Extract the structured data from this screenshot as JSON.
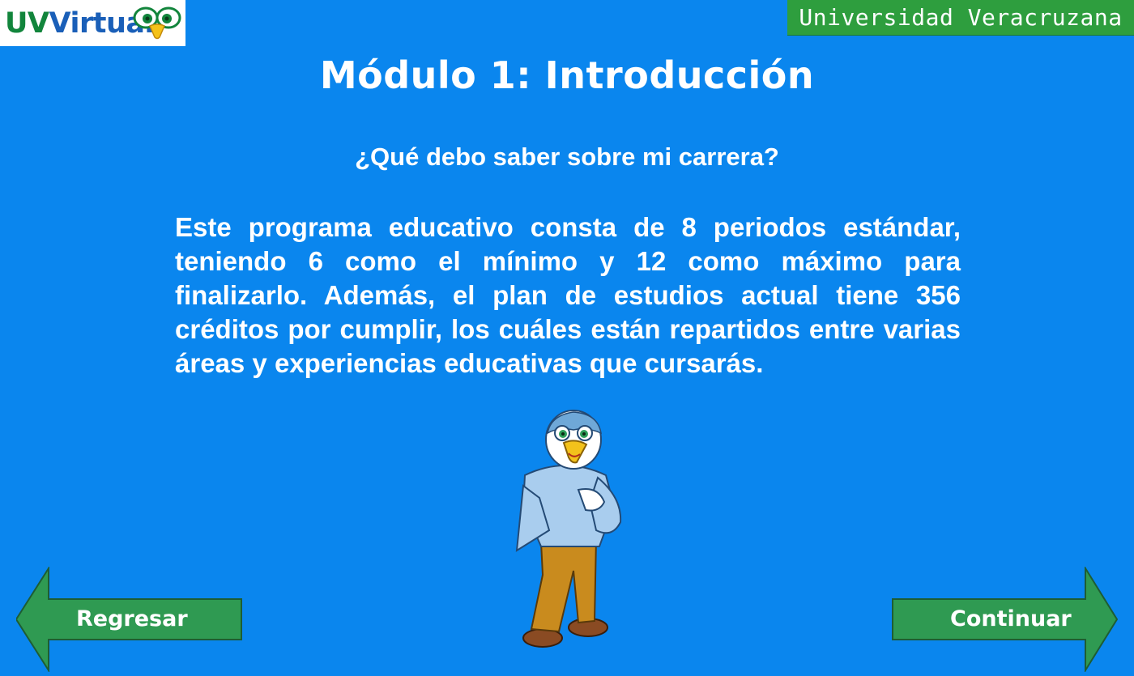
{
  "header": {
    "logo_prefix": "UV",
    "logo_suffix": "irtual",
    "logo_v": "V",
    "institution": "Universidad Veracruzana"
  },
  "main": {
    "title": "Módulo 1: Introducción",
    "question": "¿Qué debo saber sobre mi carrera?",
    "paragraph": "Este programa educativo consta de 8 periodos estándar, teniendo 6 como el mínimo y 12 como máximo para finalizarlo. Además, el plan de estudios actual tiene 356 créditos por cumplir, los cuáles están repartidos entre varias áreas y experiencias educativas que cursarás."
  },
  "nav": {
    "back_label": "Regresar",
    "next_label": "Continuar"
  },
  "colors": {
    "background": "#0a86ee",
    "banner_green": "#2e9e3e",
    "arrow_green": "#2f9a52",
    "logo_green": "#12853c",
    "logo_blue": "#1a5fb8"
  },
  "icons": {
    "logo": "owl-eyes-icon",
    "mascot": "falcon-mascot",
    "back": "left-arrow-icon",
    "next": "right-arrow-icon"
  }
}
